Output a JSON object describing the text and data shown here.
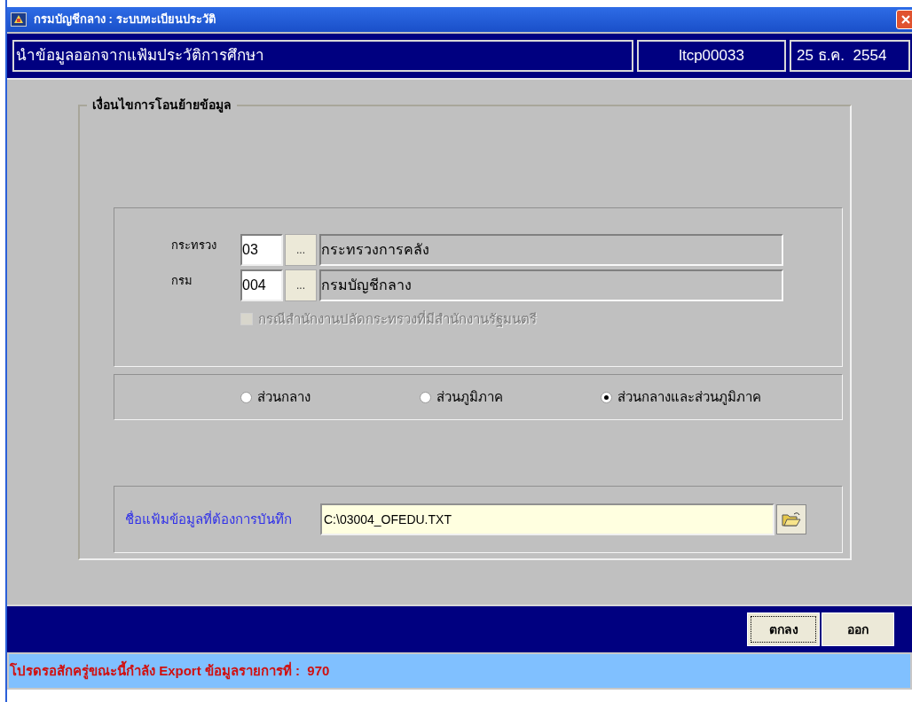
{
  "window": {
    "title": "กรมบัญชีกลาง : ระบบทะเบียนประวัติ"
  },
  "header": {
    "title": "นำข้อมูลออกจากแฟ้มประวัติการศึกษา",
    "user": "ltcp00033",
    "date": "25 ธ.ค.  2554"
  },
  "group": {
    "legend": "เงื่อนไขการโอนย้ายข้อมูล"
  },
  "fields": [
    {
      "label": "กระทรวง",
      "code": "03",
      "browse": "...",
      "name": "กระทรวงการคลัง"
    },
    {
      "label": "กรม",
      "code": "004",
      "browse": "...",
      "name": "กรมบัญชีกลาง"
    }
  ],
  "checkbox": {
    "label": "กรณีสำนักงานปลัดกระทรวงที่มีสำนักงานรัฐมนตรี",
    "checked": false,
    "disabled": true
  },
  "radios": [
    {
      "label": "ส่วนกลาง",
      "selected": false
    },
    {
      "label": "ส่วนภูมิภาค",
      "selected": false
    },
    {
      "label": "ส่วนกลางและส่วนภูมิภาค",
      "selected": true
    }
  ],
  "file": {
    "label": "ชื่อแฟ้มข้อมูลที่ต้องการบันทึก",
    "value": "C:\\03004_OFEDU.TXT"
  },
  "buttons": [
    {
      "label": "ตกลง",
      "focused": true
    },
    {
      "label": "ออก",
      "focused": false
    }
  ],
  "status_bar": "โปรดรอสักครู่ขณะนี้กำลัง Export ข้อมูลรายการที่ :  970"
}
